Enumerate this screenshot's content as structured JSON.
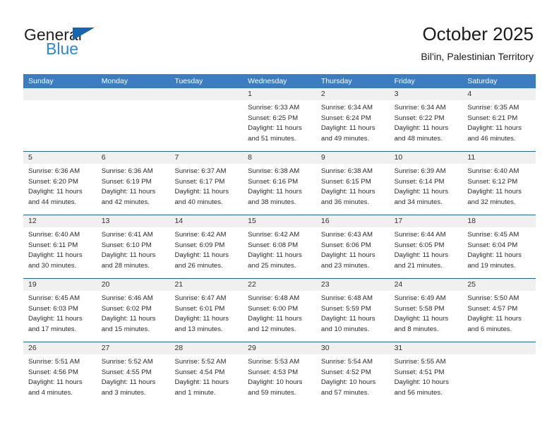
{
  "brand": {
    "name_top": "General",
    "name_bottom": "Blue",
    "triangle_icon": "triangle-icon",
    "color_dark": "#231f20",
    "color_blue": "#2e86d6",
    "color_triangle": "#1565b0"
  },
  "header": {
    "title": "October 2025",
    "subtitle": "Bil'in, Palestinian Territory"
  },
  "theme": {
    "header_bg": "#3b7dc0",
    "row_divider": "#1f63ab",
    "day_number_bg": "#f0f0f0",
    "text": "#2a2a2a"
  },
  "calendar": {
    "weekdays": [
      "Sunday",
      "Monday",
      "Tuesday",
      "Wednesday",
      "Thursday",
      "Friday",
      "Saturday"
    ],
    "weeks": [
      [
        {
          "day": "",
          "lines": []
        },
        {
          "day": "",
          "lines": []
        },
        {
          "day": "",
          "lines": []
        },
        {
          "day": "1",
          "lines": [
            "Sunrise: 6:33 AM",
            "Sunset: 6:25 PM",
            "Daylight: 11 hours",
            "and 51 minutes."
          ]
        },
        {
          "day": "2",
          "lines": [
            "Sunrise: 6:34 AM",
            "Sunset: 6:24 PM",
            "Daylight: 11 hours",
            "and 49 minutes."
          ]
        },
        {
          "day": "3",
          "lines": [
            "Sunrise: 6:34 AM",
            "Sunset: 6:22 PM",
            "Daylight: 11 hours",
            "and 48 minutes."
          ]
        },
        {
          "day": "4",
          "lines": [
            "Sunrise: 6:35 AM",
            "Sunset: 6:21 PM",
            "Daylight: 11 hours",
            "and 46 minutes."
          ]
        }
      ],
      [
        {
          "day": "5",
          "lines": [
            "Sunrise: 6:36 AM",
            "Sunset: 6:20 PM",
            "Daylight: 11 hours",
            "and 44 minutes."
          ]
        },
        {
          "day": "6",
          "lines": [
            "Sunrise: 6:36 AM",
            "Sunset: 6:19 PM",
            "Daylight: 11 hours",
            "and 42 minutes."
          ]
        },
        {
          "day": "7",
          "lines": [
            "Sunrise: 6:37 AM",
            "Sunset: 6:17 PM",
            "Daylight: 11 hours",
            "and 40 minutes."
          ]
        },
        {
          "day": "8",
          "lines": [
            "Sunrise: 6:38 AM",
            "Sunset: 6:16 PM",
            "Daylight: 11 hours",
            "and 38 minutes."
          ]
        },
        {
          "day": "9",
          "lines": [
            "Sunrise: 6:38 AM",
            "Sunset: 6:15 PM",
            "Daylight: 11 hours",
            "and 36 minutes."
          ]
        },
        {
          "day": "10",
          "lines": [
            "Sunrise: 6:39 AM",
            "Sunset: 6:14 PM",
            "Daylight: 11 hours",
            "and 34 minutes."
          ]
        },
        {
          "day": "11",
          "lines": [
            "Sunrise: 6:40 AM",
            "Sunset: 6:12 PM",
            "Daylight: 11 hours",
            "and 32 minutes."
          ]
        }
      ],
      [
        {
          "day": "12",
          "lines": [
            "Sunrise: 6:40 AM",
            "Sunset: 6:11 PM",
            "Daylight: 11 hours",
            "and 30 minutes."
          ]
        },
        {
          "day": "13",
          "lines": [
            "Sunrise: 6:41 AM",
            "Sunset: 6:10 PM",
            "Daylight: 11 hours",
            "and 28 minutes."
          ]
        },
        {
          "day": "14",
          "lines": [
            "Sunrise: 6:42 AM",
            "Sunset: 6:09 PM",
            "Daylight: 11 hours",
            "and 26 minutes."
          ]
        },
        {
          "day": "15",
          "lines": [
            "Sunrise: 6:42 AM",
            "Sunset: 6:08 PM",
            "Daylight: 11 hours",
            "and 25 minutes."
          ]
        },
        {
          "day": "16",
          "lines": [
            "Sunrise: 6:43 AM",
            "Sunset: 6:06 PM",
            "Daylight: 11 hours",
            "and 23 minutes."
          ]
        },
        {
          "day": "17",
          "lines": [
            "Sunrise: 6:44 AM",
            "Sunset: 6:05 PM",
            "Daylight: 11 hours",
            "and 21 minutes."
          ]
        },
        {
          "day": "18",
          "lines": [
            "Sunrise: 6:45 AM",
            "Sunset: 6:04 PM",
            "Daylight: 11 hours",
            "and 19 minutes."
          ]
        }
      ],
      [
        {
          "day": "19",
          "lines": [
            "Sunrise: 6:45 AM",
            "Sunset: 6:03 PM",
            "Daylight: 11 hours",
            "and 17 minutes."
          ]
        },
        {
          "day": "20",
          "lines": [
            "Sunrise: 6:46 AM",
            "Sunset: 6:02 PM",
            "Daylight: 11 hours",
            "and 15 minutes."
          ]
        },
        {
          "day": "21",
          "lines": [
            "Sunrise: 6:47 AM",
            "Sunset: 6:01 PM",
            "Daylight: 11 hours",
            "and 13 minutes."
          ]
        },
        {
          "day": "22",
          "lines": [
            "Sunrise: 6:48 AM",
            "Sunset: 6:00 PM",
            "Daylight: 11 hours",
            "and 12 minutes."
          ]
        },
        {
          "day": "23",
          "lines": [
            "Sunrise: 6:48 AM",
            "Sunset: 5:59 PM",
            "Daylight: 11 hours",
            "and 10 minutes."
          ]
        },
        {
          "day": "24",
          "lines": [
            "Sunrise: 6:49 AM",
            "Sunset: 5:58 PM",
            "Daylight: 11 hours",
            "and 8 minutes."
          ]
        },
        {
          "day": "25",
          "lines": [
            "Sunrise: 5:50 AM",
            "Sunset: 4:57 PM",
            "Daylight: 11 hours",
            "and 6 minutes."
          ]
        }
      ],
      [
        {
          "day": "26",
          "lines": [
            "Sunrise: 5:51 AM",
            "Sunset: 4:56 PM",
            "Daylight: 11 hours",
            "and 4 minutes."
          ]
        },
        {
          "day": "27",
          "lines": [
            "Sunrise: 5:52 AM",
            "Sunset: 4:55 PM",
            "Daylight: 11 hours",
            "and 3 minutes."
          ]
        },
        {
          "day": "28",
          "lines": [
            "Sunrise: 5:52 AM",
            "Sunset: 4:54 PM",
            "Daylight: 11 hours",
            "and 1 minute."
          ]
        },
        {
          "day": "29",
          "lines": [
            "Sunrise: 5:53 AM",
            "Sunset: 4:53 PM",
            "Daylight: 10 hours",
            "and 59 minutes."
          ]
        },
        {
          "day": "30",
          "lines": [
            "Sunrise: 5:54 AM",
            "Sunset: 4:52 PM",
            "Daylight: 10 hours",
            "and 57 minutes."
          ]
        },
        {
          "day": "31",
          "lines": [
            "Sunrise: 5:55 AM",
            "Sunset: 4:51 PM",
            "Daylight: 10 hours",
            "and 56 minutes."
          ]
        },
        {
          "day": "",
          "lines": []
        }
      ]
    ]
  }
}
